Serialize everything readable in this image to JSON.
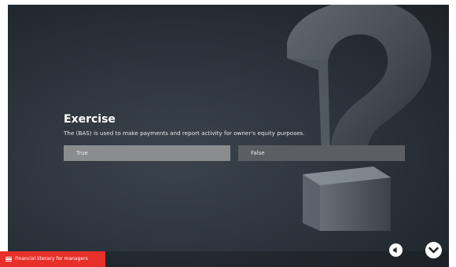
{
  "exercise": {
    "title": "Exercise",
    "question": "The (BAS) is used to make payments and report activity for owner's equity purposes."
  },
  "options": [
    {
      "label": "True"
    },
    {
      "label": "False"
    }
  ],
  "footer": {
    "menu_label": "Financial literacy for managers"
  },
  "icons": {
    "menu": "hamburger-menu-icon",
    "audio": "speaker-icon",
    "next": "chevron-down-icon"
  },
  "colors": {
    "brand_red": "#e8302a",
    "option_true_bg": "#8a8c8e",
    "option_false_bg": "#5b5f63",
    "backdrop": "#2f363f"
  }
}
